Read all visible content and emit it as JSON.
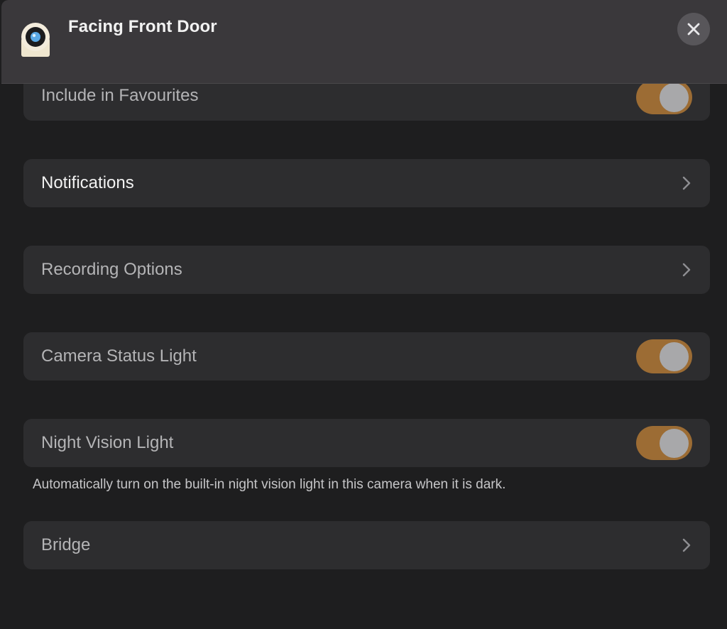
{
  "window": {
    "title": "Facing Front Door",
    "icons": {
      "device": "camera-device-icon",
      "close": "close-icon"
    }
  },
  "settings": {
    "favourites": {
      "label": "Include in Favourites",
      "on": true
    },
    "notifications": {
      "label": "Notifications"
    },
    "recording": {
      "label": "Recording Options"
    },
    "status_light": {
      "label": "Camera Status Light",
      "on": true
    },
    "night_vision": {
      "label": "Night Vision Light",
      "on": true,
      "footnote": "Automatically turn on the built-in night vision light in this camera when it is dark."
    },
    "bridge": {
      "label": "Bridge"
    }
  },
  "colors": {
    "toggle_on": "#9c6c34",
    "row_background": "#2d2d2f",
    "window_background": "#1e1e1f",
    "header_background": "#3a383b"
  }
}
